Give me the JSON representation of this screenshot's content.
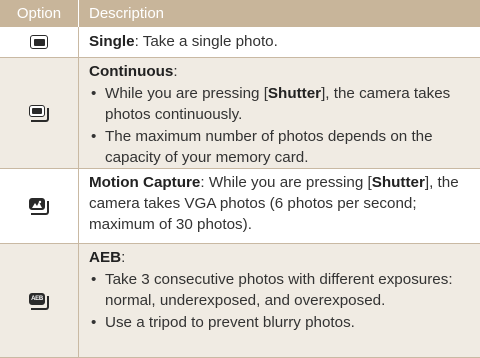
{
  "header": {
    "option": "Option",
    "description": "Description"
  },
  "rows": [
    {
      "icon": "single-shot-icon",
      "title": "Single",
      "text": ": Take a single photo."
    },
    {
      "icon": "continuous-shot-icon",
      "title": "Continuous",
      "title_suffix": ":",
      "bullets": [
        {
          "pre": "While you are pressing [",
          "key": "Shutter",
          "post": "], the camera takes photos continuously."
        },
        {
          "text": "The maximum number of photos depends on the capacity of your memory card."
        }
      ]
    },
    {
      "icon": "motion-capture-icon",
      "title": "Motion Capture",
      "pre": ": While you are pressing [",
      "key": "Shutter",
      "post": "], the camera takes VGA photos (6 photos per second; maximum of 30 photos)."
    },
    {
      "icon": "aeb-icon",
      "icon_text": "AEB",
      "title": "AEB",
      "title_suffix": ":",
      "bullets": [
        {
          "text": "Take 3 consecutive photos with different exposures: normal, underexposed, and overexposed."
        },
        {
          "text": "Use a tripod to prevent blurry photos."
        }
      ]
    }
  ]
}
